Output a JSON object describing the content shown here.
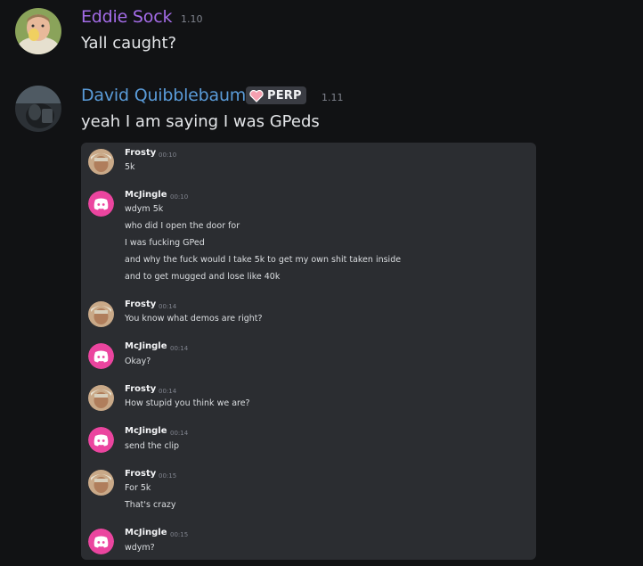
{
  "messages": [
    {
      "username": "Eddie Sock",
      "username_color": "#a46ce8",
      "timestamp": "1.10",
      "content": "Yall caught?"
    },
    {
      "username": "David Quibblebaum",
      "username_color": "#5a9bd8",
      "badge": {
        "icon": "heart-icon",
        "label": "PERP"
      },
      "timestamp": "1.11",
      "content": "yeah I am saying I was GPeds"
    }
  ],
  "embed": {
    "messages": [
      {
        "username": "Frosty",
        "avatar": "frosty-avatar",
        "timestamp": "00:10",
        "lines": [
          "5k"
        ]
      },
      {
        "username": "McJingle",
        "avatar": "discord-logo-avatar",
        "timestamp": "00:10",
        "lines": [
          "wdym 5k",
          "who did I open the door for",
          "I was fucking GPed",
          "and why the fuck would I take 5k to get my own shit taken inside",
          "and to get mugged and lose like 40k"
        ]
      },
      {
        "username": "Frosty",
        "avatar": "frosty-avatar",
        "timestamp": "00:14",
        "lines": [
          "You know what demos are right?"
        ]
      },
      {
        "username": "McJingle",
        "avatar": "discord-logo-avatar",
        "timestamp": "00:14",
        "lines": [
          "Okay?"
        ]
      },
      {
        "username": "Frosty",
        "avatar": "frosty-avatar",
        "timestamp": "00:14",
        "lines": [
          "How stupid you think we are?"
        ]
      },
      {
        "username": "McJingle",
        "avatar": "discord-logo-avatar",
        "timestamp": "00:14",
        "lines": [
          "send the clip"
        ]
      },
      {
        "username": "Frosty",
        "avatar": "frosty-avatar",
        "timestamp": "00:15",
        "lines": [
          "For 5k",
          "That's crazy"
        ]
      },
      {
        "username": "McJingle",
        "avatar": "discord-logo-avatar",
        "timestamp": "00:15",
        "lines": [
          "wdym?"
        ]
      }
    ]
  },
  "colors": {
    "background": "#111214",
    "embed_background": "#2b2d31",
    "discord_pink": "#eb459f",
    "timestamp": "#80848e"
  }
}
